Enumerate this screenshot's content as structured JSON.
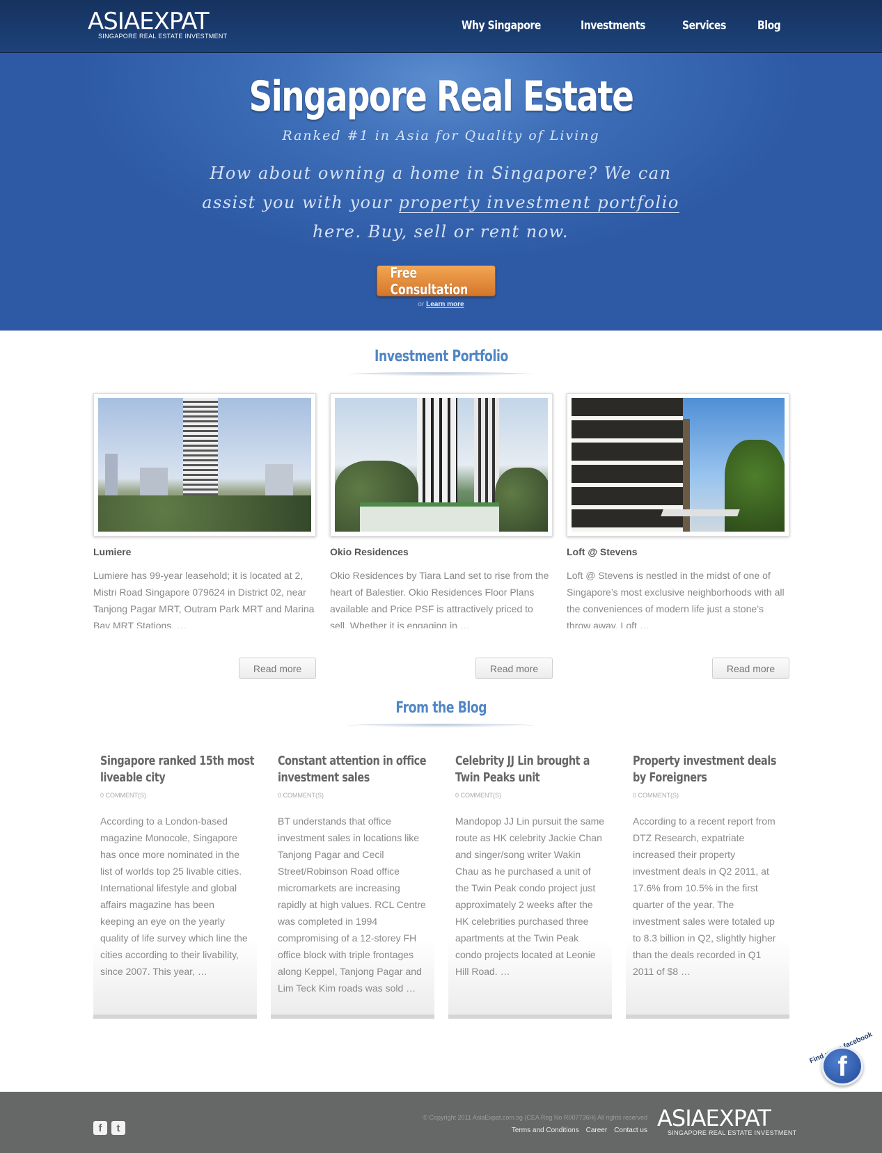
{
  "brand": {
    "name_left": "ASIA",
    "name_right": "EXPAT",
    "tagline": "SINGAPORE REAL ESTATE INVESTMENT"
  },
  "nav": [
    "Why Singapore",
    "Investments",
    "Services",
    "Blog"
  ],
  "hero": {
    "title": "Singapore Real Estate",
    "subtitle": "Ranked #1 in Asia for Quality of Living",
    "pitch_1": "How about owning a home in Singapore? We can assist you with your ",
    "pitch_link": "property investment portfolio",
    "pitch_2": " here. Buy, sell or rent now.",
    "cta": "Free Consultation",
    "learn_prefix": "or",
    "learn_link": "Learn more"
  },
  "portfolio": {
    "heading": "Investment Portfolio",
    "items": [
      {
        "title": "Lumiere",
        "text": "Lumiere has 99-year leasehold; it is located at 2, Mistri Road Singapore 079624 in District 02, near Tanjong Pagar MRT, Outram Park MRT and Marina Bay MRT Stations. …",
        "button": "Read more"
      },
      {
        "title": "Okio Residences",
        "text": "Okio Residences by Tiara Land set to rise from the heart of Balestier. Okio Residences Floor Plans available and Price PSF is attractively priced to sell. Whether it is engaging in …",
        "button": "Read more"
      },
      {
        "title": "Loft @ Stevens",
        "text": "Loft @ Stevens is nestled in the midst of one of Singapore’s most exclusive neighborhoods with all the conveniences of modern life just a stone’s throw away. Loft …",
        "button": "Read more"
      }
    ]
  },
  "blog": {
    "heading": "From the Blog",
    "posts": [
      {
        "title": "Singapore ranked 15th most liveable city",
        "comments": "0 COMMENT(S)",
        "text": "According to a London-based magazine Monocole, Singapore has once more nominated in the list of worlds top 25 livable cities. International lifestyle and global affairs magazine has been keeping an eye on the yearly quality of life survey which line the cities according to their livability, since 2007. This year, …"
      },
      {
        "title": "Constant attention in office investment sales",
        "comments": "0 COMMENT(S)",
        "text": "BT understands that office investment sales in locations like Tanjong Pagar and Cecil Street/Robinson Road office micromarkets are increasing rapidly at high values. RCL Centre was completed in 1994 compromising of a 12-storey FH office block with triple frontages along Keppel, Tanjong Pagar and Lim Teck Kim roads was sold …"
      },
      {
        "title": "Celebrity JJ Lin brought a Twin Peaks unit",
        "comments": "0 COMMENT(S)",
        "text": "Mandopop JJ Lin pursuit the same route as HK celebrity Jackie Chan and singer/song writer Wakin Chau as he purchased a unit of the Twin Peak condo project just approximately 2 weeks after the HK celebrities purchased three apartments at the Twin Peak condo projects located at Leonie Hill Road. …"
      },
      {
        "title": "Property investment deals by Foreigners",
        "comments": "0 COMMENT(S)",
        "text": "According to a recent report from DTZ Research, expatriate increased their property investment deals in Q2 2011, at 17.6% from 10.5% in the first quarter of the year. The investment sales were totaled up to 8.3 billion in Q2, slightly higher than the deals recorded in Q1 2011 of $8 …"
      }
    ]
  },
  "facebook_badge": {
    "text": "Find us on facebook",
    "glyph": "f",
    "icon": "facebook-icon"
  },
  "footer": {
    "copyright": "© Copyright 2011 AsiaExpat.com.sg (CEA Reg No R007736H) All rights reserved",
    "links": [
      "Terms and Conditions",
      "Career",
      "Contact us"
    ],
    "social": [
      {
        "icon": "facebook-icon",
        "glyph": "f"
      },
      {
        "icon": "twitter-icon",
        "glyph": "t"
      }
    ]
  }
}
